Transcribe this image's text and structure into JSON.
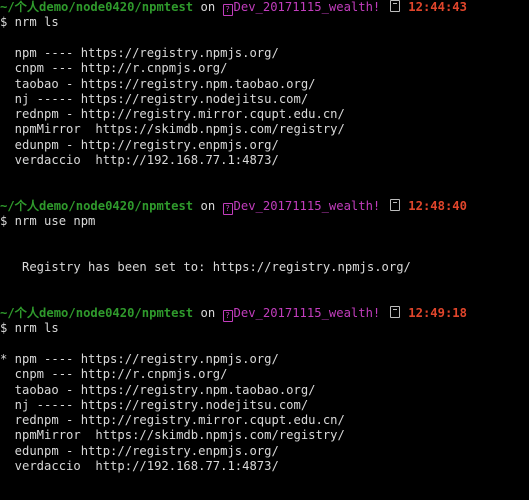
{
  "colors": {
    "background": "#000000",
    "text": "#d9d9d9",
    "path": "#2f9a2c",
    "branch": "#c23dbd",
    "time": "#e0452b"
  },
  "prompt": {
    "path": "~/个人demo/node0420/npmtest",
    "on": "on",
    "git_icon_glyph": "?",
    "branch": "Dev_20171115_wealth!",
    "clock_icon": "clock-icon"
  },
  "blocks": [
    {
      "time": "12:44:43",
      "command": "$ nrm ls",
      "output": [
        "  npm ---- https://registry.npmjs.org/",
        "  cnpm --- http://r.cnpmjs.org/",
        "  taobao - https://registry.npm.taobao.org/",
        "  nj ----- https://registry.nodejitsu.com/",
        "  rednpm - http://registry.mirror.cqupt.edu.cn/",
        "  npmMirror  https://skimdb.npmjs.com/registry/",
        "  edunpm - http://registry.enpmjs.org/",
        "  verdaccio  http://192.168.77.1:4873/"
      ]
    },
    {
      "time": "12:48:40",
      "command": "$ nrm use npm",
      "output": [
        "   Registry has been set to: https://registry.npmjs.org/"
      ]
    },
    {
      "time": "12:49:18",
      "command": "$ nrm ls",
      "output": [
        "* npm ---- https://registry.npmjs.org/",
        "  cnpm --- http://r.cnpmjs.org/",
        "  taobao - https://registry.npm.taobao.org/",
        "  nj ----- https://registry.nodejitsu.com/",
        "  rednpm - http://registry.mirror.cqupt.edu.cn/",
        "  npmMirror  https://skimdb.npmjs.com/registry/",
        "  edunpm - http://registry.enpmjs.org/",
        "  verdaccio  http://192.168.77.1:4873/"
      ]
    }
  ]
}
